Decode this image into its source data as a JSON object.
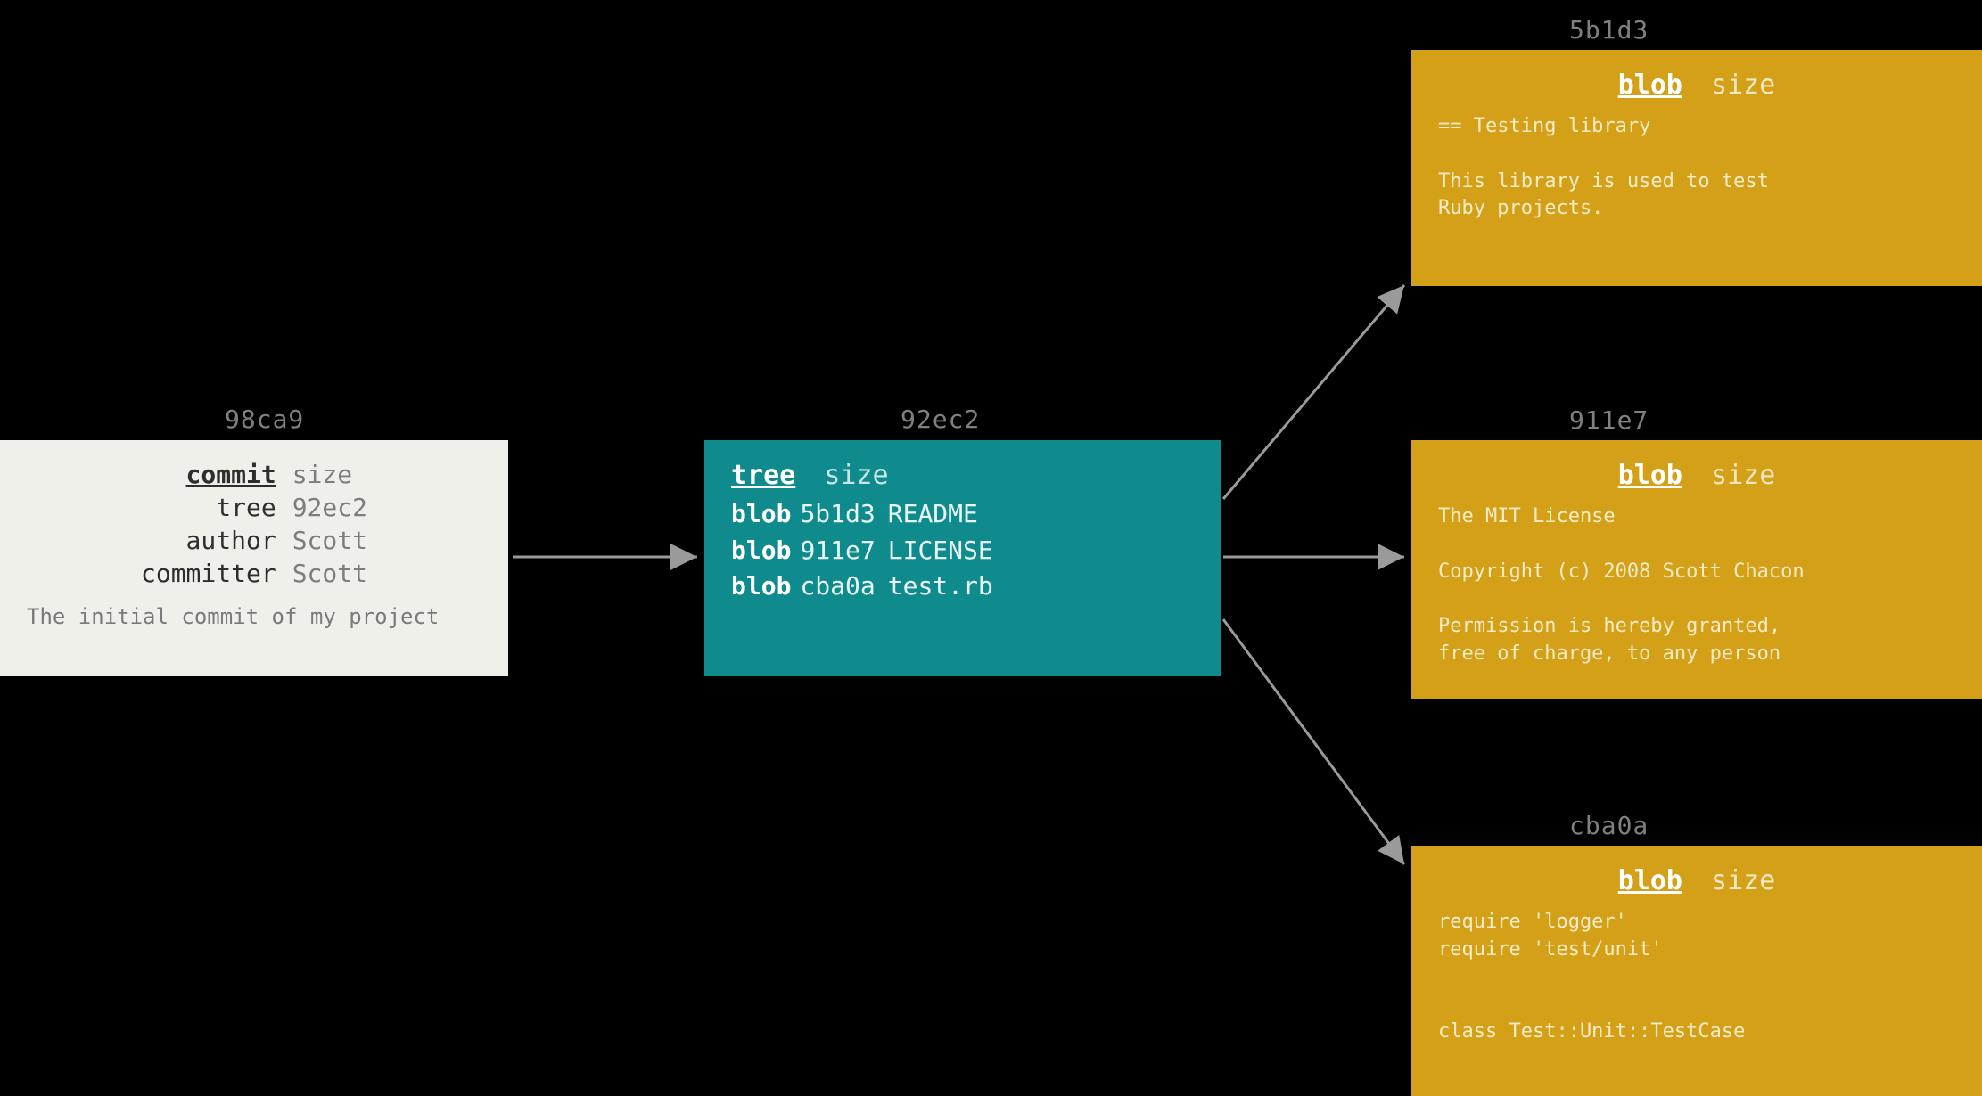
{
  "commit": {
    "hash": "98ca9",
    "type": "commit",
    "size_label": "size",
    "fields": {
      "tree_key": "tree",
      "tree_val": "92ec2",
      "author_key": "author",
      "author_val": "Scott",
      "committer_key": "committer",
      "committer_val": "Scott"
    },
    "message": "The initial commit of my project"
  },
  "tree": {
    "hash": "92ec2",
    "type": "tree",
    "size_label": "size",
    "entries": [
      {
        "etype": "blob",
        "ehash": "5b1d3",
        "ename": "README"
      },
      {
        "etype": "blob",
        "ehash": "911e7",
        "ename": "LICENSE"
      },
      {
        "etype": "blob",
        "ehash": "cba0a",
        "ename": "test.rb"
      }
    ]
  },
  "blobs": [
    {
      "hash": "5b1d3",
      "type": "blob",
      "size_label": "size",
      "body": "== Testing library\n\nThis library is used to test\nRuby projects."
    },
    {
      "hash": "911e7",
      "type": "blob",
      "size_label": "size",
      "body": "The MIT License\n\nCopyright (c) 2008 Scott Chacon\n\nPermission is hereby granted,\nfree of charge, to any person"
    },
    {
      "hash": "cba0a",
      "type": "blob",
      "size_label": "size",
      "body": "require 'logger'\nrequire 'test/unit'\n\n\nclass Test::Unit::TestCase"
    }
  ]
}
